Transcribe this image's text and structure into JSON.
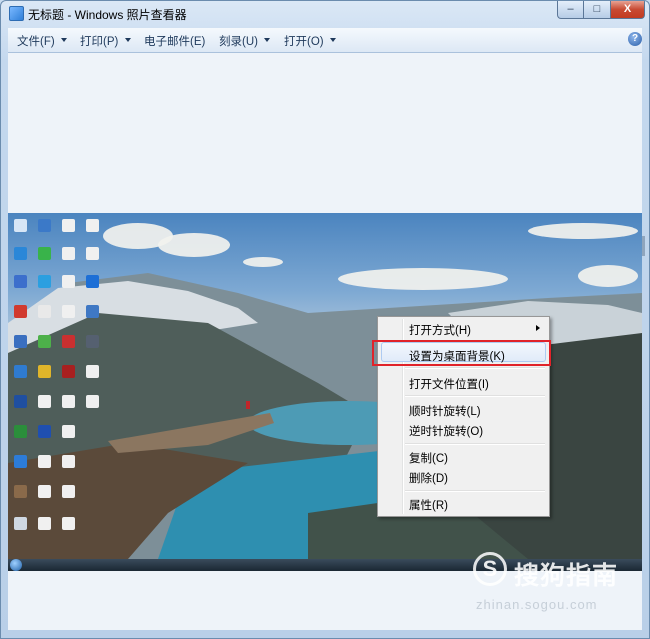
{
  "window": {
    "title": "无标题 - Windows 照片查看器",
    "controls": {
      "minimize": "–",
      "maximize": "□",
      "close": "X"
    }
  },
  "menubar": {
    "items": [
      {
        "label": "文件(F)",
        "has_dropdown": true
      },
      {
        "label": "打印(P)",
        "has_dropdown": true
      },
      {
        "label": "电子邮件(E)",
        "has_dropdown": false
      },
      {
        "label": "刻录(U)",
        "has_dropdown": true
      },
      {
        "label": "打开(O)",
        "has_dropdown": true
      }
    ],
    "help": "?"
  },
  "context_menu": {
    "items": [
      {
        "label": "打开方式(H)",
        "submenu": true
      },
      {
        "label": "设置为桌面背景(K)",
        "highlighted": true
      },
      {
        "label": "打开文件位置(I)"
      },
      {
        "label": "顺时针旋转(L)"
      },
      {
        "label": "逆时针旋转(O)"
      },
      {
        "label": "复制(C)"
      },
      {
        "label": "删除(D)"
      },
      {
        "label": "属性(R)"
      }
    ]
  },
  "watermark": {
    "logo": "S",
    "text": "搜狗指南",
    "url": "zhinan.sogou.com"
  },
  "colors": {
    "highlight_box": "#e0232a",
    "menubar": "#dde8f5",
    "viewer_bg": "#eef3f9"
  }
}
